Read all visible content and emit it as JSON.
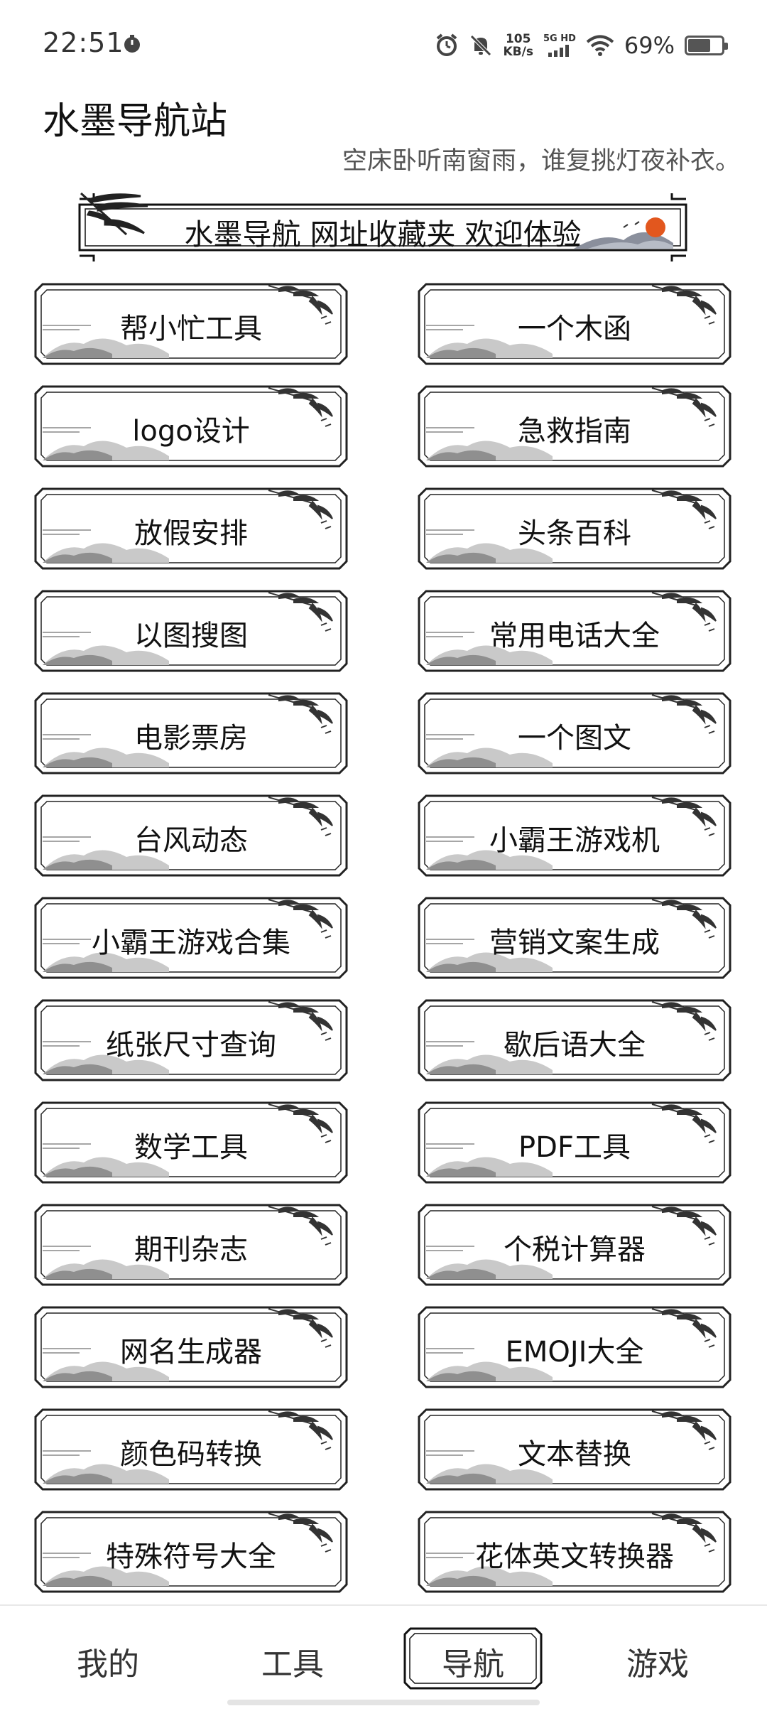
{
  "status_bar": {
    "time": "22:51",
    "net_speed_value": "105",
    "net_speed_unit": "KB/s",
    "network_label": "5G HD",
    "battery_percent": "69%",
    "battery_level": 0.69
  },
  "header": {
    "title": "水墨导航站",
    "poem": "空床卧听南窗雨，谁复挑灯夜补衣。"
  },
  "banner": {
    "text": "水墨导航 网址收藏夹 欢迎体验"
  },
  "grid": {
    "items": [
      "帮小忙工具",
      "一个木函",
      "logo设计",
      "急救指南",
      "放假安排",
      "头条百科",
      "以图搜图",
      "常用电话大全",
      "电影票房",
      "一个图文",
      "台风动态",
      "小霸王游戏机",
      "小霸王游戏合集",
      "营销文案生成",
      "纸张尺寸查询",
      "歇后语大全",
      "数学工具",
      "PDF工具",
      "期刊杂志",
      "个税计算器",
      "网名生成器",
      "EMOJI大全",
      "颜色码转换",
      "文本替换",
      "特殊符号大全",
      "花体英文转换器"
    ]
  },
  "bottom_nav": {
    "items": [
      "我的",
      "工具",
      "导航",
      "游戏"
    ],
    "active": "导航"
  },
  "colors": {
    "ink": "#111111",
    "mountain": "#9a9a9a",
    "sun": "#e2571e"
  }
}
